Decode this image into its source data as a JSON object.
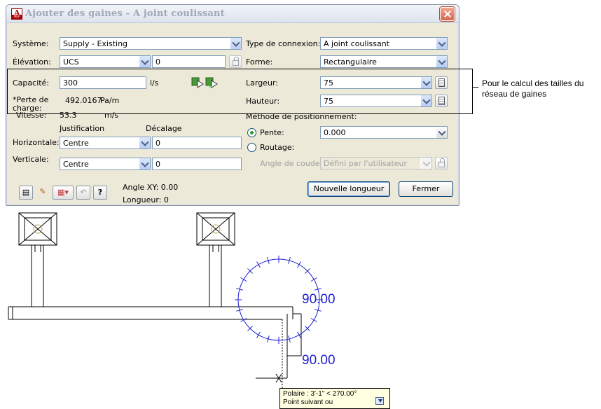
{
  "dialog": {
    "title": "Ajouter des gaines - A joint coulissant",
    "systeme_label": "Système:",
    "systeme_value": "Supply - Existing",
    "elevation_label": "Élévation:",
    "elevation_ref": "UCS",
    "elevation_value": "0",
    "capacite_label": "Capacité:",
    "capacite_value": "300",
    "capacite_unit": "l/s",
    "perte_label": "*Perte de charge:",
    "perte_value": "492.0167",
    "perte_unit": "Pa/m",
    "vitesse_label": "Vitesse:",
    "vitesse_value": "53.3",
    "vitesse_unit": "m/s",
    "justification_label": "Justification",
    "decalage_label": "Décalage",
    "horizontale_label": "Horizontale:",
    "horizontale_value": "Centre",
    "horizontale_offset": "0",
    "verticale_label": "Verticale:",
    "verticale_value": "Centre",
    "verticale_offset": "0",
    "angle_xy": "Angle XY:  0.00",
    "longueur": "Longueur:  0",
    "type_connexion_label": "Type de connexion:",
    "type_connexion_value": "A joint coulissant",
    "forme_label": "Forme:",
    "forme_value": "Rectangulaire",
    "largeur_label": "Largeur:",
    "largeur_value": "75",
    "hauteur_label": "Hauteur:",
    "hauteur_value": "75",
    "methode_label": "Méthode de positionnement:",
    "pente_label": "Pente:",
    "pente_value": "0.000",
    "routage_label": "Routage:",
    "angle_coude_label": "Angle de coude:",
    "angle_coude_value": "Défini par l'utilisateur",
    "nouvelle_longueur_btn": "Nouvelle longueur",
    "fermer_btn": "Fermer",
    "pente_selected": true
  },
  "callout": {
    "text": "Pour le calcul des tailles du réseau de gaines"
  },
  "drawing": {
    "angle_label_1": "90.00",
    "angle_label_2": "90.00",
    "line_color": "#000000",
    "compass_color": "#2020d0"
  },
  "tooltip": {
    "line1": "Polaire : 3'-1\" < 270.00°",
    "line2": "Point suivant ou"
  }
}
